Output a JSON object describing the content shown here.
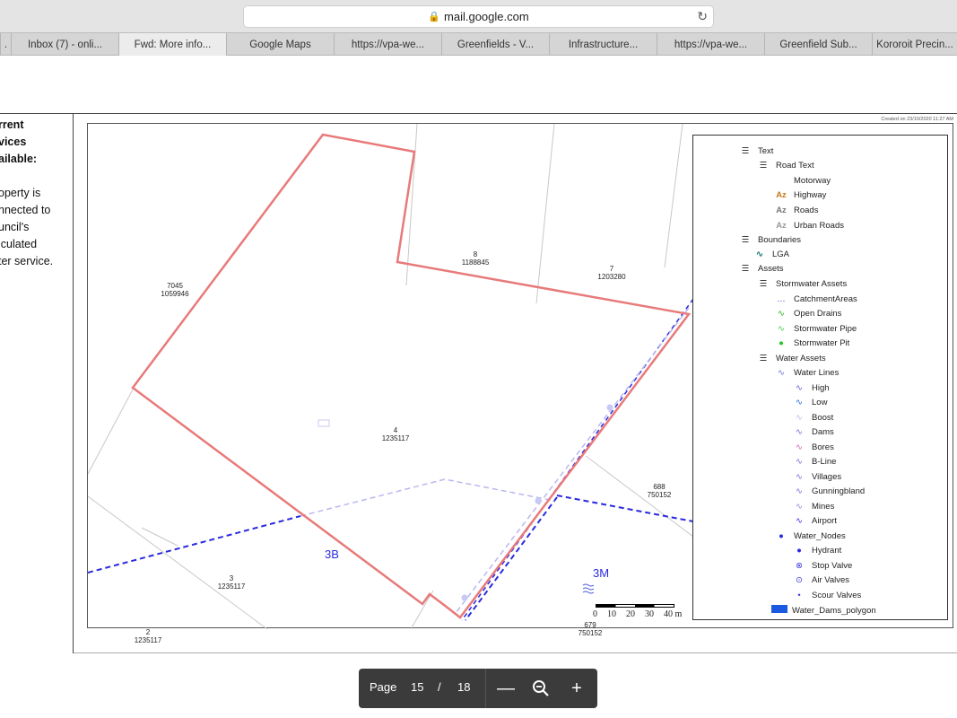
{
  "browser": {
    "address": "mail.google.com",
    "tabs": [
      {
        "label": ".",
        "active": false
      },
      {
        "label": "Inbox (7) - onli...",
        "active": false
      },
      {
        "label": "Fwd: More info...",
        "active": true
      },
      {
        "label": "Google Maps",
        "active": false
      },
      {
        "label": "https://vpa-we...",
        "active": false
      },
      {
        "label": "Greenfields - V...",
        "active": false
      },
      {
        "label": "Infrastructure...",
        "active": false
      },
      {
        "label": "https://vpa-we...",
        "active": false
      },
      {
        "label": "Greenfield Sub...",
        "active": false
      },
      {
        "label": "Kororoit Precin...",
        "active": false
      }
    ]
  },
  "document": {
    "heading_lines": [
      "rrent",
      "vices",
      "ailable:"
    ],
    "body_lines": [
      "operty is",
      "nnected to",
      "uncil's",
      "iculated",
      "ter service."
    ]
  },
  "map": {
    "created_note": "Created on 23/10/2020 11:27 AM",
    "parcels": [
      {
        "lot": "7045",
        "plan": "1059946"
      },
      {
        "lot": "8",
        "plan": "1188845"
      },
      {
        "lot": "7",
        "plan": "1203280"
      },
      {
        "lot": "4",
        "plan": "1235117"
      },
      {
        "lot": "688",
        "plan": "750152"
      },
      {
        "lot": "3",
        "plan": "1235117"
      },
      {
        "lot": "2",
        "plan": "1235117"
      },
      {
        "lot": "679",
        "plan": "750152"
      }
    ],
    "zones": [
      "3B",
      "3M"
    ],
    "scale": {
      "labels": [
        "0",
        "10",
        "20",
        "30",
        "40 m"
      ]
    },
    "legend": {
      "text": "Text",
      "road_text": "Road Text",
      "motorway": "Motorway",
      "highway": "Highway",
      "roads": "Roads",
      "urban_roads": "Urban Roads",
      "boundaries": "Boundaries",
      "lga": "LGA",
      "assets": "Assets",
      "stormwater_assets": "Stormwater Assets",
      "catchment_areas": "CatchmentAreas",
      "open_drains": "Open Drains",
      "stormwater_pipe": "Stormwater Pipe",
      "stormwater_pit": "Stormwater Pit",
      "water_assets": "Water Assets",
      "water_lines": "Water Lines",
      "high": "High",
      "low": "Low",
      "boost": "Boost",
      "dams": "Dams",
      "bores": "Bores",
      "b_line": "B-Line",
      "villages": "Villages",
      "gunningbland": "Gunningbland",
      "mines": "Mines",
      "airport": "Airport",
      "water_nodes": "Water_Nodes",
      "hydrant": "Hydrant",
      "stop_valve": "Stop Valve",
      "air_valves": "Air Valves",
      "scour_valves": "Scour Valves",
      "water_dams_polygon": "Water_Dams_polygon",
      "az_glyph": "Az"
    }
  },
  "pdf_toolbar": {
    "page_label": "Page",
    "current_page": "15",
    "separator": "/",
    "total_pages": "18"
  },
  "colors": {
    "parcel_outline": "#e87a7a",
    "water_line": "#2a2ae0",
    "water_line_light": "#b8b8f0",
    "toolbar_bg": "#3b3b3b"
  }
}
